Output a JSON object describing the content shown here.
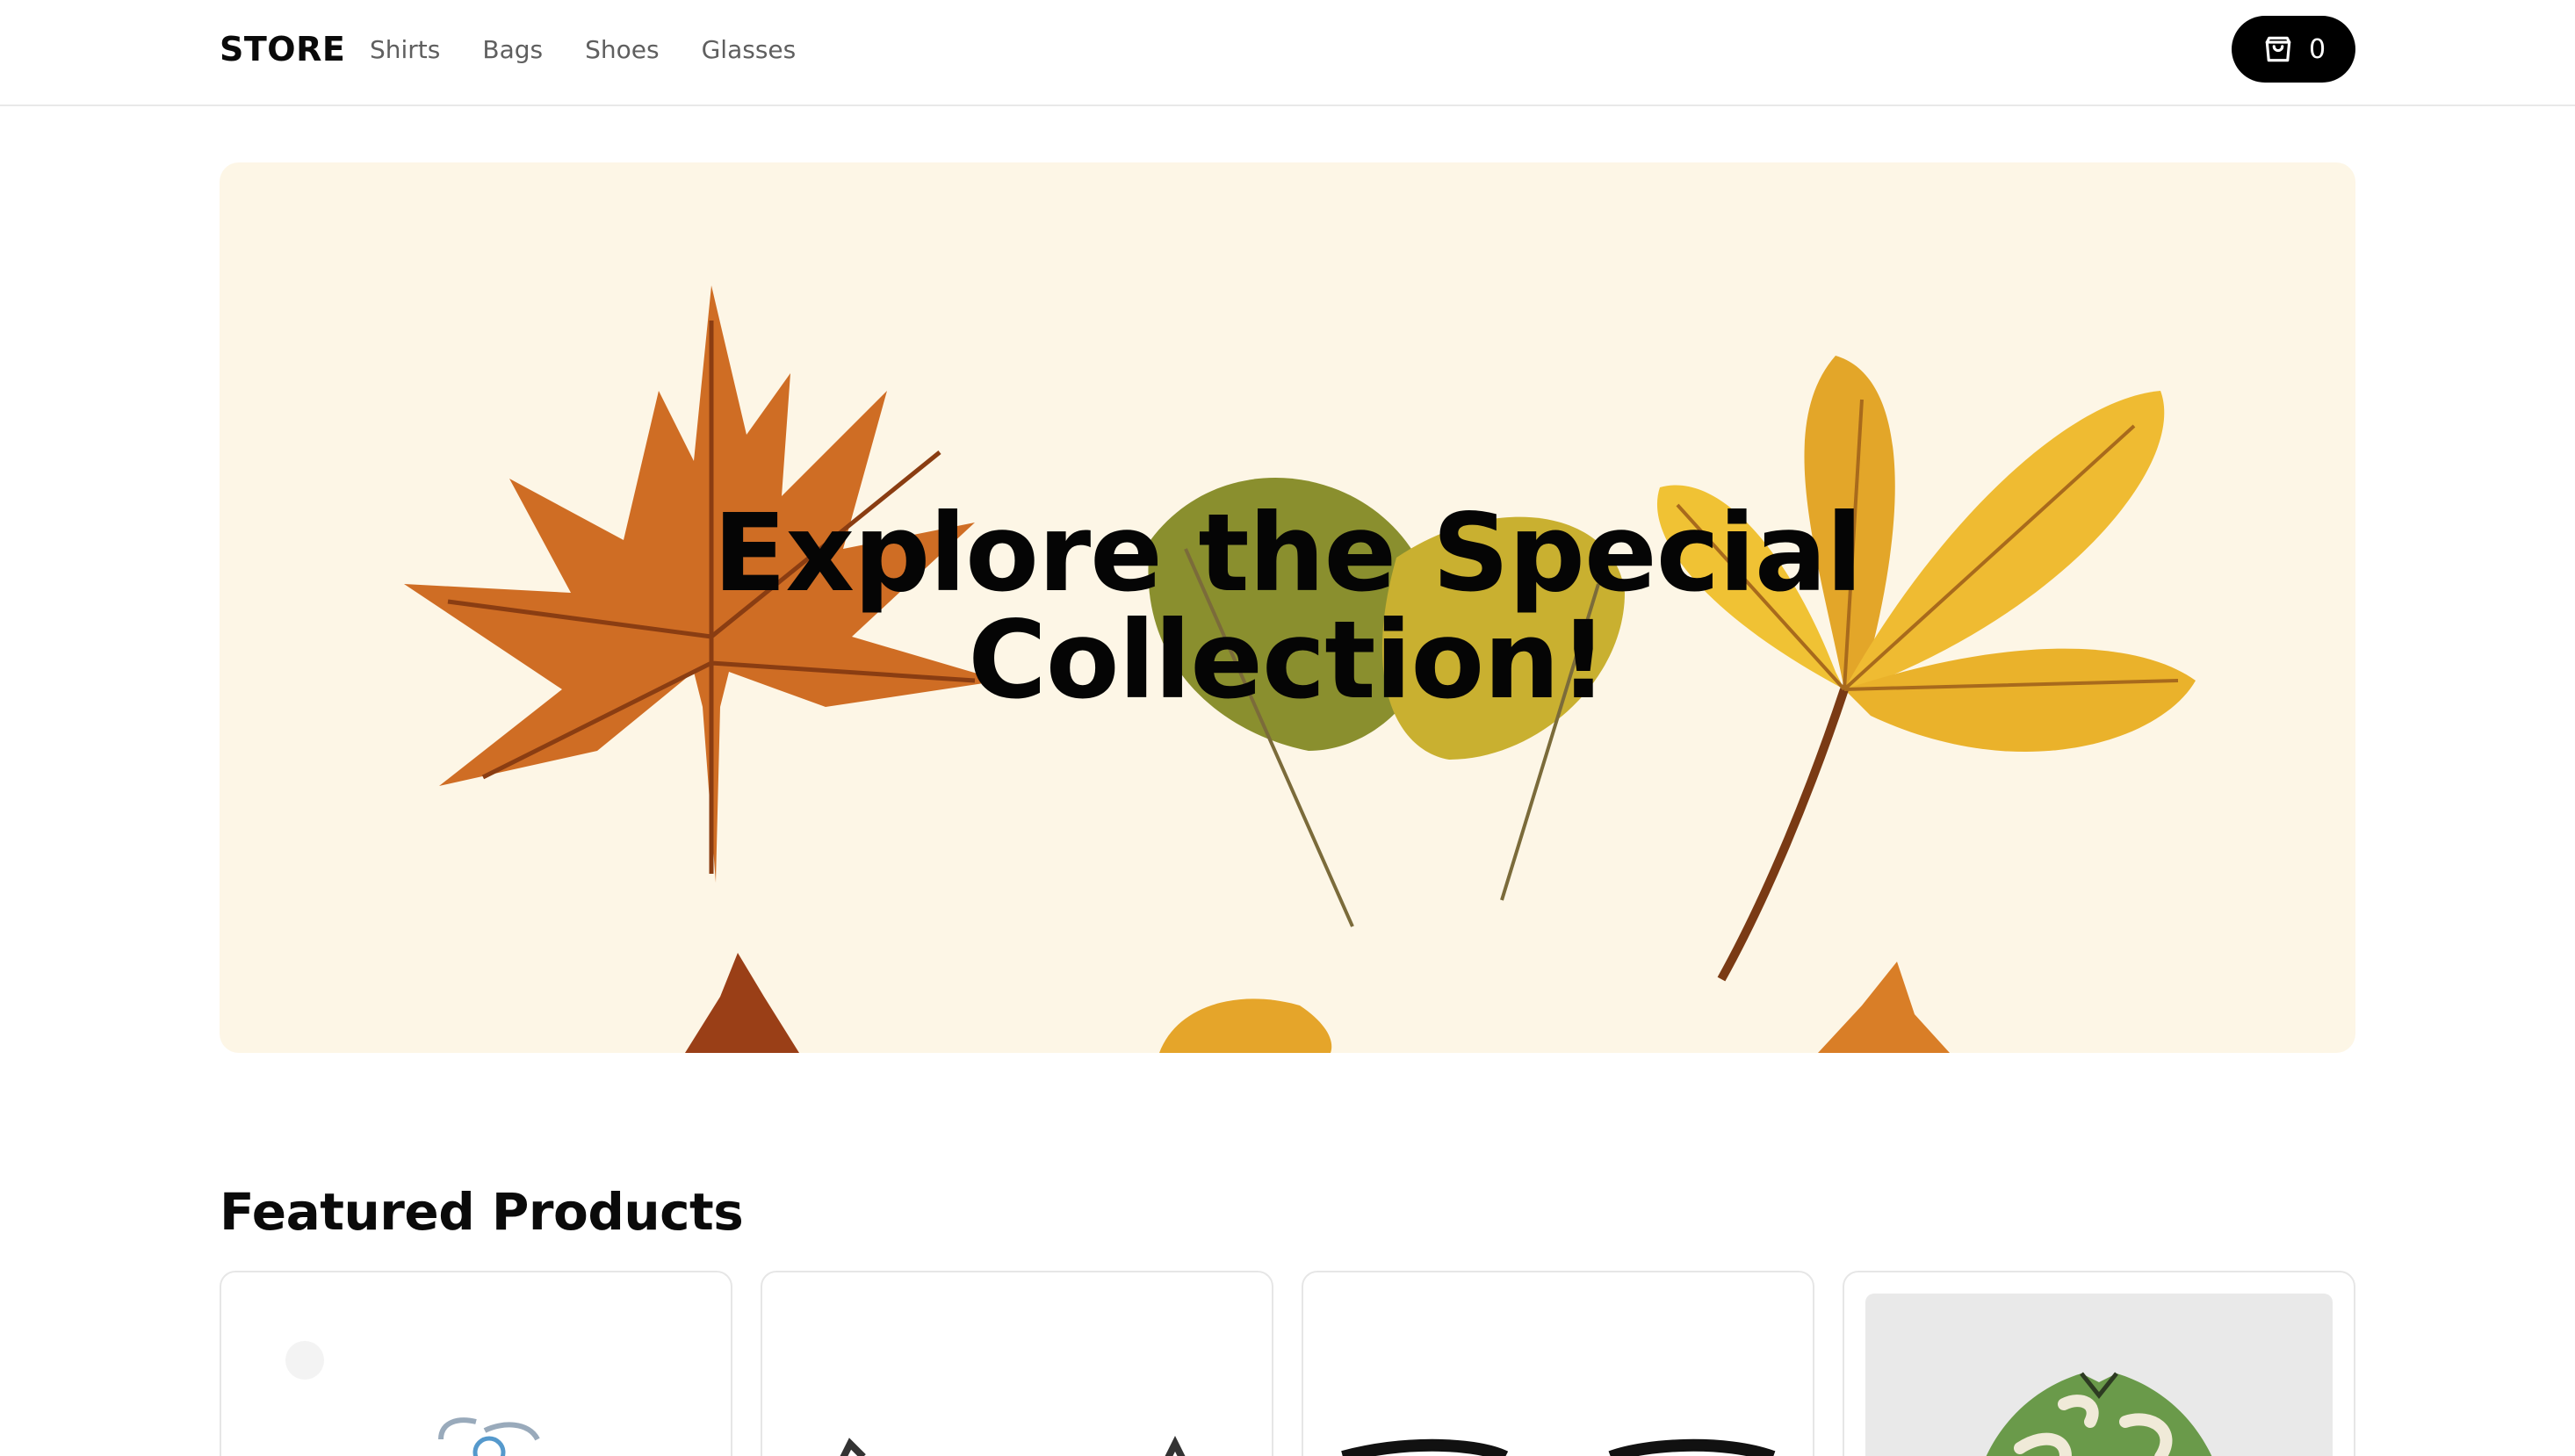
{
  "header": {
    "logo": "STORE",
    "nav": [
      "Shirts",
      "Bags",
      "Shoes",
      "Glasses"
    ],
    "cart_count": "0",
    "cart_icon": "shopping-bag-icon"
  },
  "hero": {
    "title_line1": "Explore the Special",
    "title_line2": "Collection!",
    "background_color": "#fdf6e6"
  },
  "featured": {
    "title": "Featured Products",
    "products": [
      {
        "image": "glasses-image"
      },
      {
        "image": "sunglasses-image"
      },
      {
        "image": "sunglasses-image"
      },
      {
        "image": "shirt-image"
      }
    ]
  }
}
